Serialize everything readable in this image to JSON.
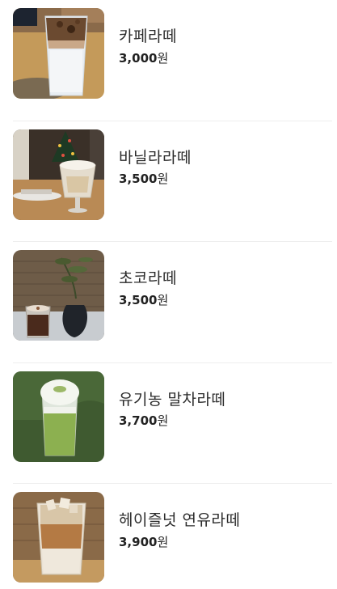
{
  "menu": {
    "items": [
      {
        "name": "카페라떼",
        "price": "3,000",
        "unit": "원",
        "image": "cafe-latte-photo"
      },
      {
        "name": "바닐라라떼",
        "price": "3,500",
        "unit": "원",
        "image": "vanilla-latte-photo"
      },
      {
        "name": "초코라떼",
        "price": "3,500",
        "unit": "원",
        "image": "choco-latte-photo"
      },
      {
        "name": "유기농 말차라떼",
        "price": "3,700",
        "unit": "원",
        "image": "matcha-latte-photo"
      },
      {
        "name": "헤이즐넛 연유라떼",
        "price": "3,900",
        "unit": "원",
        "image": "hazelnut-condensed-milk-latte-photo"
      }
    ]
  }
}
